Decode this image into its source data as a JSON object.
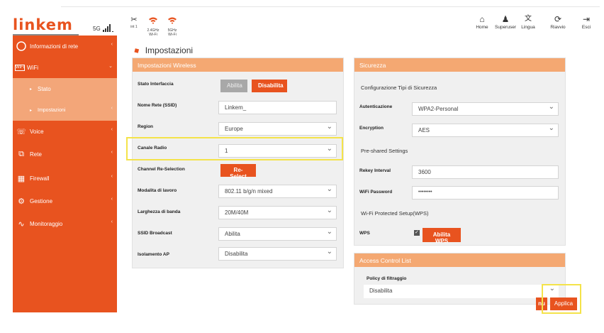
{
  "header": {
    "logo": "linkem",
    "signal_label": "5G",
    "icons": [
      {
        "name": "signal-bars-icon",
        "glyph": "✂",
        "label": "int 1"
      },
      {
        "name": "wifi-24-icon",
        "glyph": "📶",
        "label": "2.4GHz\nWi-Fi"
      },
      {
        "name": "wifi-5-icon",
        "glyph": "📶",
        "label": "5GHz\nWi-Fi"
      }
    ],
    "nav": [
      {
        "name": "home",
        "glyph": "⌂",
        "label": "Home"
      },
      {
        "name": "superuser",
        "glyph": "♟",
        "label": "Superuser"
      },
      {
        "name": "lingua",
        "glyph": "文",
        "label": "Lingua"
      },
      {
        "name": "riavvio",
        "glyph": "⟳",
        "label": "Riavvio"
      },
      {
        "name": "esci",
        "glyph": "⇥",
        "label": "Esci"
      }
    ]
  },
  "sidebar": {
    "items": [
      {
        "label": "Informazioni di rete",
        "icon": "info-icon"
      },
      {
        "label": "WiFi",
        "icon": "wifi-icon"
      },
      {
        "label": "Stato",
        "sub": true
      },
      {
        "label": "Impostazioni",
        "sub": true
      },
      {
        "label": "Voice",
        "icon": "phone-icon"
      },
      {
        "label": "Rete",
        "icon": "network-icon"
      },
      {
        "label": "Firewall",
        "icon": "firewall-icon"
      },
      {
        "label": "Gestione",
        "icon": "gear-icon"
      },
      {
        "label": "Monitoraggio",
        "icon": "monitor-icon"
      }
    ]
  },
  "page": {
    "title": "Impostazioni"
  },
  "wireless": {
    "header": "Impostazioni Wireless",
    "stato_label": "Stato Interfaccia",
    "abilita": "Abilita",
    "disabilita": "Disabilita",
    "ssid_label": "Nome Rete (SSID)",
    "ssid_value": "Linkem_",
    "region_label": "Region",
    "region_value": "Europe",
    "canale_label": "Canale Radio",
    "canale_value": "1",
    "reselect_label": "Channel Re-Selection",
    "reselect_btn": "Re-Select",
    "modalita_label": "Modalita di lavoro",
    "modalita_value": "802.11 b/g/n mixed",
    "banda_label": "Larghezza di banda",
    "banda_value": "20M/40M",
    "broadcast_label": "SSID Broadcast",
    "broadcast_value": "Abilita",
    "isolamento_label": "Isolamento AP",
    "isolamento_value": "Disabilita"
  },
  "security": {
    "header": "Sicurezza",
    "config_title": "Configurazione Tipi di Sicurezza",
    "auth_label": "Autenticazione",
    "auth_value": "WPA2-Personal",
    "enc_label": "Encryption",
    "enc_value": "AES",
    "psk_title": "Pre-shared Settings",
    "rekey_label": "Rekey Interval",
    "rekey_value": "3600",
    "pwd_label": "WiFi Password",
    "pwd_value": "••••••••",
    "wps_title": "Wi-Fi Protected Setup(WPS)",
    "wps_label": "WPS",
    "wps_btn": "Abilita WPS"
  },
  "acl": {
    "header": "Access Control List",
    "policy_label": "Policy di filtraggio",
    "policy_value": "Disabilita"
  },
  "footer": {
    "cancel_btn": "nu",
    "apply_btn": "Applica"
  }
}
